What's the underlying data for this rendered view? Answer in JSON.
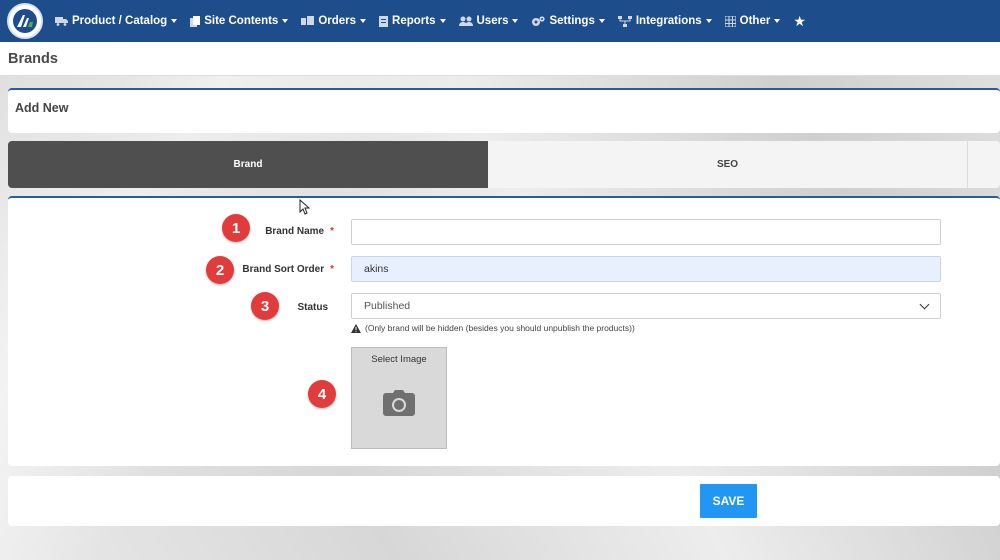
{
  "nav": {
    "items": [
      {
        "label": "Product / Catalog",
        "icon": "truck-icon"
      },
      {
        "label": "Site Contents",
        "icon": "files-icon"
      },
      {
        "label": "Orders",
        "icon": "orders-icon"
      },
      {
        "label": "Reports",
        "icon": "report-icon"
      },
      {
        "label": "Users",
        "icon": "users-icon"
      },
      {
        "label": "Settings",
        "icon": "gears-icon"
      },
      {
        "label": "Integrations",
        "icon": "sitemap-icon"
      },
      {
        "label": "Other",
        "icon": "grid-icon"
      }
    ],
    "star_icon": "star-icon",
    "color": "#1e4d8c"
  },
  "page": {
    "title": "Brands"
  },
  "add_new": {
    "title": "Add New"
  },
  "tabs": [
    {
      "label": "Brand",
      "active": true
    },
    {
      "label": "SEO",
      "active": false
    }
  ],
  "form": {
    "brand_name": {
      "label": "Brand Name",
      "required_mark": "*",
      "value": "",
      "badge": "1"
    },
    "sort_order": {
      "label": "Brand Sort Order",
      "required_mark": "*",
      "value": "akins",
      "badge": "2"
    },
    "status": {
      "label": "Status",
      "value": "Published",
      "badge": "3"
    },
    "status_hint": "(Only brand will be hidden (besides you should unpublish the products))",
    "image": {
      "label": "Select Image",
      "badge": "4"
    }
  },
  "save": {
    "label": "SAVE",
    "color": "#2196f3"
  }
}
